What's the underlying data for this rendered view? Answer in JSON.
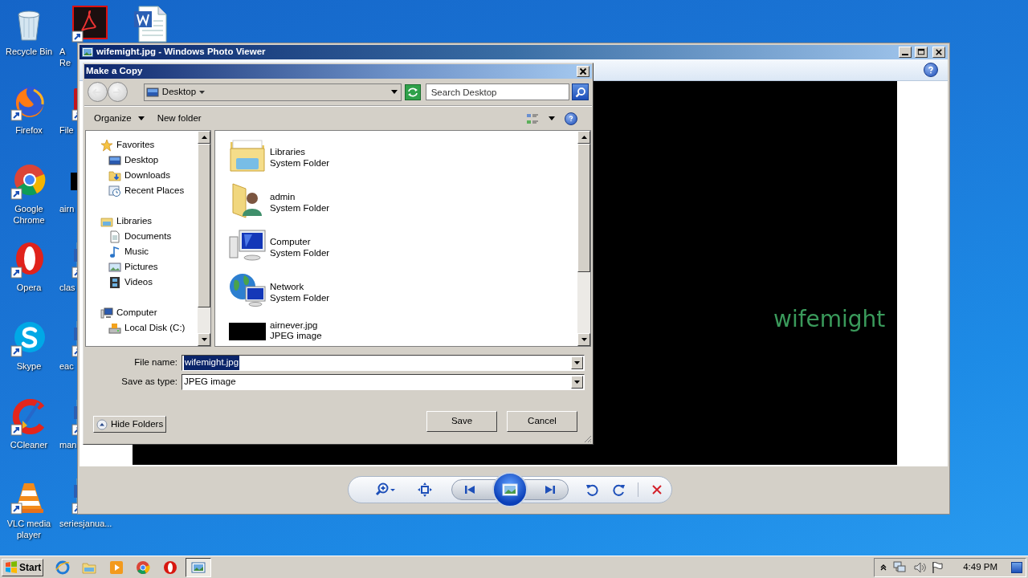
{
  "desktop": {
    "columns": [
      [
        {
          "kind": "recycle_bin",
          "label": [
            "Recycle Bin"
          ]
        },
        {
          "kind": "firefox",
          "label": [
            "Firefox"
          ]
        },
        {
          "kind": "chrome",
          "label": [
            "Google",
            "Chrome"
          ]
        },
        {
          "kind": "opera",
          "label": [
            "Opera"
          ]
        },
        {
          "kind": "skype",
          "label": [
            "Skype"
          ]
        },
        {
          "kind": "ccleaner",
          "label": [
            "CCleaner"
          ]
        },
        {
          "kind": "vlc",
          "label": [
            "VLC media",
            "player"
          ]
        }
      ],
      [
        {
          "kind": "pdf",
          "label": [
            "A",
            "Re"
          ]
        },
        {
          "kind": "app",
          "label": [
            "File"
          ]
        },
        {
          "kind": "thumb",
          "label": [
            "airn"
          ]
        },
        {
          "kind": "doc",
          "label": [
            "clas"
          ]
        },
        {
          "kind": "doc",
          "label": [
            "eac"
          ]
        },
        {
          "kind": "doc",
          "label": [
            "man"
          ]
        },
        {
          "kind": "doc",
          "label": [
            "seriesjanua..."
          ]
        }
      ],
      [
        {
          "kind": "word"
        }
      ]
    ]
  },
  "photo_viewer": {
    "title": "wifemight.jpg - Windows Photo Viewer",
    "image_caption": "wifemight"
  },
  "dialog": {
    "title": "Make a Copy",
    "location": "Desktop",
    "search": {
      "placeholder": "Search Desktop"
    },
    "organize": "Organize",
    "new_folder": "New folder",
    "nav": [
      {
        "label": "Favorites",
        "kind": "favorites",
        "children": [
          {
            "label": "Desktop",
            "kind": "desktop"
          },
          {
            "label": "Downloads",
            "kind": "downloads"
          },
          {
            "label": "Recent Places",
            "kind": "recent"
          }
        ]
      },
      {
        "label": "Libraries",
        "kind": "libraries",
        "children": [
          {
            "label": "Documents",
            "kind": "documents"
          },
          {
            "label": "Music",
            "kind": "music"
          },
          {
            "label": "Pictures",
            "kind": "pictures"
          },
          {
            "label": "Videos",
            "kind": "videos"
          }
        ]
      },
      {
        "label": "Computer",
        "kind": "computer",
        "children": [
          {
            "label": "Local Disk (C:)",
            "kind": "disk"
          }
        ]
      }
    ],
    "files": [
      {
        "name": "Libraries",
        "details": [
          "System Folder"
        ],
        "kind": "libraries"
      },
      {
        "name": "admin",
        "details": [
          "System Folder"
        ],
        "kind": "user"
      },
      {
        "name": "Computer",
        "details": [
          "System Folder"
        ],
        "kind": "computer"
      },
      {
        "name": "Network",
        "details": [
          "System Folder"
        ],
        "kind": "network"
      },
      {
        "name": "airnever.jpg",
        "details": [
          "JPEG image"
        ],
        "kind": "image"
      }
    ],
    "file_name": {
      "label": "File name:",
      "value": "wifemight.jpg",
      "text_selected": true
    },
    "save_type": {
      "label": "Save as type:",
      "value": "JPEG image"
    },
    "hide_folders": "Hide Folders",
    "buttons": [
      "Save",
      "Cancel"
    ]
  },
  "taskbar": {
    "start": "Start",
    "apps": [
      {
        "active": false
      },
      {
        "active": false
      },
      {
        "active": false
      },
      {
        "active": false
      },
      {
        "active": false
      },
      {
        "active": true
      }
    ],
    "clock": "4:49 PM"
  }
}
